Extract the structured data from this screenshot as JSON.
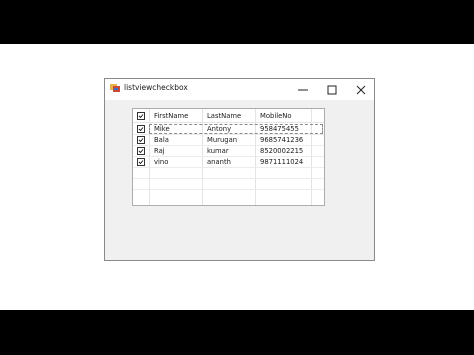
{
  "window": {
    "title": "listviewcheckbox"
  },
  "listview": {
    "columns": [
      "FirstName",
      "LastName",
      "MobileNo"
    ],
    "rows": [
      {
        "checked": true,
        "first": "Mike",
        "last": "Antony",
        "mobile": "958475455"
      },
      {
        "checked": true,
        "first": "Bala",
        "last": "Murugan",
        "mobile": "9685741236"
      },
      {
        "checked": true,
        "first": "Raj",
        "last": "kumar",
        "mobile": "8520002215"
      },
      {
        "checked": true,
        "first": "vino",
        "last": "ananth",
        "mobile": "9871111024"
      }
    ],
    "header_checked": true
  },
  "icons": {
    "app": "listview-app-icon",
    "minimize": "minimize-icon",
    "maximize": "maximize-icon",
    "close": "close-icon",
    "check": "checkmark-icon"
  }
}
